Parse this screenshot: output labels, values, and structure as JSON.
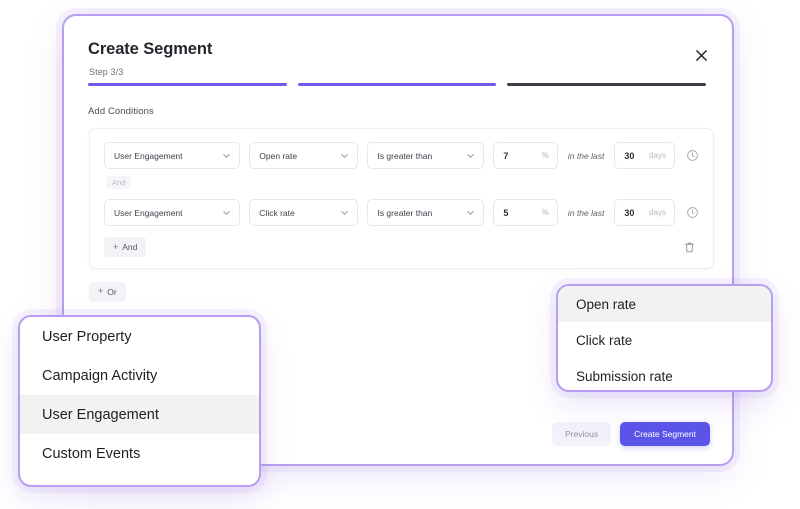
{
  "modal": {
    "title": "Create Segment",
    "close_icon": "close-icon",
    "step_label": "Step 3/3",
    "progress": {
      "total_steps": 3,
      "current_step": 3,
      "segments": [
        "done",
        "done",
        "active"
      ],
      "accent": "#6c5ce7",
      "active_color": "#3c4148"
    },
    "section_label": "Add Conditions",
    "conditions": [
      {
        "category": "User Engagement",
        "metric": "Open rate",
        "operator": "Is greater than",
        "value": "7",
        "value_unit": "%",
        "timeframe_note": "in the last",
        "timeframe_value": "30",
        "timeframe_unit": "days",
        "clock_icon": "clock-icon",
        "joiner": "And"
      },
      {
        "category": "User Engagement",
        "metric": "Click rate",
        "operator": "Is greater than",
        "value": "5",
        "value_unit": "%",
        "timeframe_note": "in the last",
        "timeframe_value": "30",
        "timeframe_unit": "days",
        "clock_icon": "clock-icon",
        "joiner": null
      }
    ],
    "add_and_label": "And",
    "add_or_label": "Or",
    "plus_glyph": "+",
    "delete_icon": "trash-icon",
    "footer": {
      "previous_label": "Previous",
      "create_label": "Create Segment",
      "primary_color": "#5b54e8"
    }
  },
  "menu_category": {
    "items": [
      {
        "label": "User Property",
        "selected": false
      },
      {
        "label": "Campaign Activity",
        "selected": false
      },
      {
        "label": "User Engagement",
        "selected": true
      },
      {
        "label": "Custom Events",
        "selected": false
      }
    ]
  },
  "menu_metric": {
    "items": [
      {
        "label": "Open rate",
        "selected": true
      },
      {
        "label": "Click rate",
        "selected": false
      },
      {
        "label": "Submission rate",
        "selected": false
      }
    ]
  }
}
